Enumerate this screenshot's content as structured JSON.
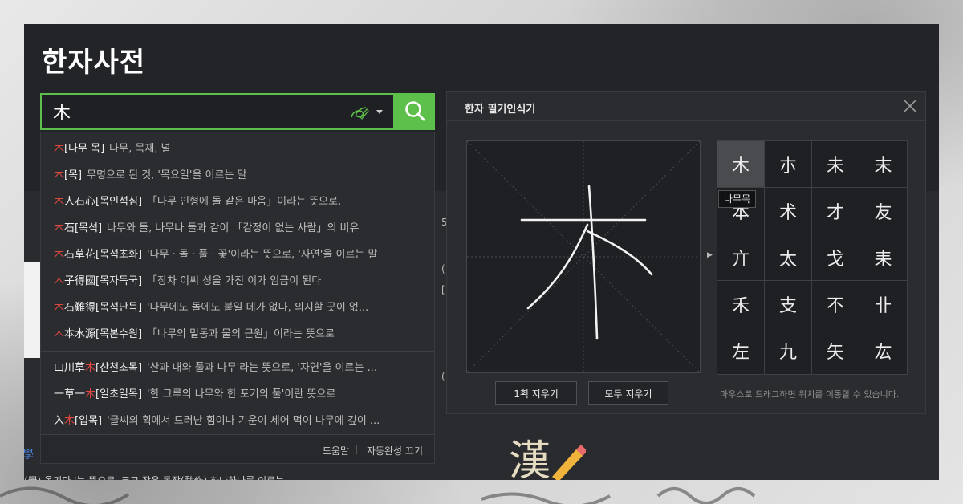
{
  "page": {
    "title": "한자사전",
    "under_link": "學",
    "under_text": "(學) 옮기다 '는 뜻으로, 크고 작은 동작(動作) 하나하나를 이르는",
    "under_right": [
      "5",
      "(",
      "[",
      "("
    ]
  },
  "search": {
    "value": "木",
    "colors": {
      "accent": "#5cc04a",
      "highlight": "#e0473f"
    },
    "icons": {
      "handwriting_toggle": "pen-icon",
      "dropdown": "caret-down-icon",
      "search": "search-icon"
    }
  },
  "autocomplete": {
    "items": [
      {
        "pre": "",
        "hl": "木",
        "post": "",
        "read": "[나무  목]",
        "mean": "나무, 목재, 널"
      },
      {
        "pre": "",
        "hl": "木",
        "post": "",
        "read": "[목]",
        "mean": "무명으로 된 것, '목요일'을 이르는 말"
      },
      {
        "pre": "",
        "hl": "木",
        "post": "人石心",
        "read": "[목인석심]",
        "mean": "「나무 인형에 돌 같은 마음」이라는 뜻으로,"
      },
      {
        "pre": "",
        "hl": "木",
        "post": "石",
        "read": "[목석]",
        "mean": "나무와 돌, 나무나 돌과 같이 「감정이 없는 사람」의 비유"
      },
      {
        "pre": "",
        "hl": "木",
        "post": "石草花",
        "read": "[목석초화]",
        "mean": "'나무 · 돌 · 풀 · 꽃'이라는 뜻으로, '자연'을 이르는 말"
      },
      {
        "pre": "",
        "hl": "木",
        "post": "子得國",
        "read": "[목자득국]",
        "mean": "「장차 이씨 성을 가진 이가 임금이 된다"
      },
      {
        "pre": "",
        "hl": "木",
        "post": "石難得",
        "read": "[목석난득]",
        "mean": "'나무에도 돌에도 붙일 데가 없다, 의지할 곳이 없..."
      },
      {
        "pre": "",
        "hl": "木",
        "post": "本水源",
        "read": "[목본수원]",
        "mean": "「나무의 밑동과 물의 근원」이라는 뜻으로"
      }
    ],
    "items2": [
      {
        "pre": "山川草",
        "hl": "木",
        "post": "",
        "read": "[산천초목]",
        "mean": "'산과 내와 풀과 나무'라는 뜻으로, '자연'을 이르는 ..."
      },
      {
        "pre": "一草一",
        "hl": "木",
        "post": "",
        "read": "[일초일목]",
        "mean": "'한 그루의 나무와 한 포기의 풀'이란 뜻으로"
      },
      {
        "pre": "入",
        "hl": "木",
        "post": "",
        "read": "[입목]",
        "mean": "'글씨의 획에서 드러난 힘이나 기운이 세어 먹이 나무에 깊이 ..."
      }
    ],
    "footer": {
      "help": "도움말",
      "toggle": "자동완성 끄기"
    }
  },
  "handwriting": {
    "title": "한자 필기인식기",
    "candidates": [
      "木",
      "朩",
      "未",
      "末",
      "本",
      "术",
      "才",
      "友",
      "亣",
      "太",
      "戈",
      "耒",
      "禾",
      "支",
      "不",
      "卝",
      "左",
      "九",
      "矢",
      "厷"
    ],
    "selected_index": 0,
    "tooltip": "나무목",
    "buttons": {
      "clear_stroke": "1획 지우기",
      "clear_all": "모두 지우기"
    },
    "hint": "마우스로 드래그하면 위치를 이동할 수 있습니다.",
    "icons": {
      "close": "close-icon",
      "arrow": "arrow-right-icon"
    }
  },
  "logo": {
    "char": "漢",
    "icon": "pencil-icon"
  }
}
